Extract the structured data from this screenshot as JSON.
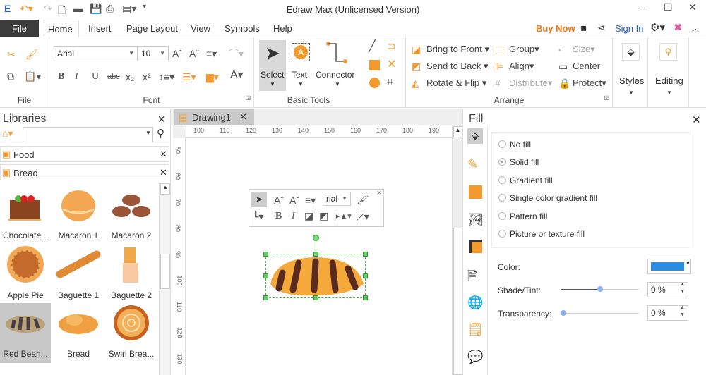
{
  "window": {
    "title": "Edraw Max (Unlicensed Version)",
    "minimize": "–",
    "maximize": "☐",
    "close": "✕"
  },
  "menu": {
    "tabs": [
      "File",
      "Home",
      "Insert",
      "Page Layout",
      "View",
      "Symbols",
      "Help"
    ],
    "buy_now": "Buy Now",
    "sign_in": "Sign In"
  },
  "ribbon": {
    "file_group": "File",
    "font": {
      "family": "Arial",
      "size": "10",
      "label": "Font"
    },
    "basic_tools": {
      "select": "Select",
      "text": "Text",
      "connector": "Connector",
      "label": "Basic Tools"
    },
    "arrange": {
      "bring_to_front": "Bring to Front",
      "send_to_back": "Send to Back",
      "rotate_flip": "Rotate & Flip",
      "group": "Group",
      "align": "Align",
      "distribute": "Distribute",
      "size": "Size",
      "center": "Center",
      "protect": "Protect",
      "label": "Arrange"
    },
    "styles": "Styles",
    "editing": "Editing"
  },
  "libraries": {
    "title": "Libraries",
    "search_placeholder": "",
    "categories": [
      "Food",
      "Bread"
    ],
    "items": [
      {
        "label": "Chocolate..."
      },
      {
        "label": "Macaron 1"
      },
      {
        "label": "Macaron 2"
      },
      {
        "label": "Apple Pie"
      },
      {
        "label": "Baguette 1"
      },
      {
        "label": "Baguette 2"
      },
      {
        "label": "Red Bean...",
        "selected": true
      },
      {
        "label": "Bread"
      },
      {
        "label": "Swirl Brea..."
      }
    ]
  },
  "document": {
    "tab": "Drawing1",
    "ruler_h": [
      "100",
      "110",
      "120",
      "130",
      "140",
      "150",
      "160",
      "170",
      "180",
      "190"
    ],
    "ruler_v": [
      "50",
      "60",
      "70",
      "80",
      "90",
      "100",
      "110",
      "120",
      "130"
    ],
    "mini_toolbar_font": "rial"
  },
  "fill": {
    "title": "Fill",
    "options": [
      {
        "label": "No fill",
        "checked": false
      },
      {
        "label": "Solid fill",
        "checked": true
      },
      {
        "label": "Gradient fill",
        "checked": false
      },
      {
        "label": "Single color gradient fill",
        "checked": false
      },
      {
        "label": "Pattern fill",
        "checked": false
      },
      {
        "label": "Picture or texture fill",
        "checked": false
      }
    ],
    "color_label": "Color:",
    "color": "#2b8de0",
    "shade_label": "Shade/Tint:",
    "shade_value": "0 %",
    "shade_slider": 0.5,
    "transparency_label": "Transparency:",
    "transparency_value": "0 %",
    "transparency_slider": 0
  },
  "colors": {
    "accent": "#f39a2e",
    "file_tab": "#3c3c3c",
    "sign_in": "#2a5bd7"
  }
}
